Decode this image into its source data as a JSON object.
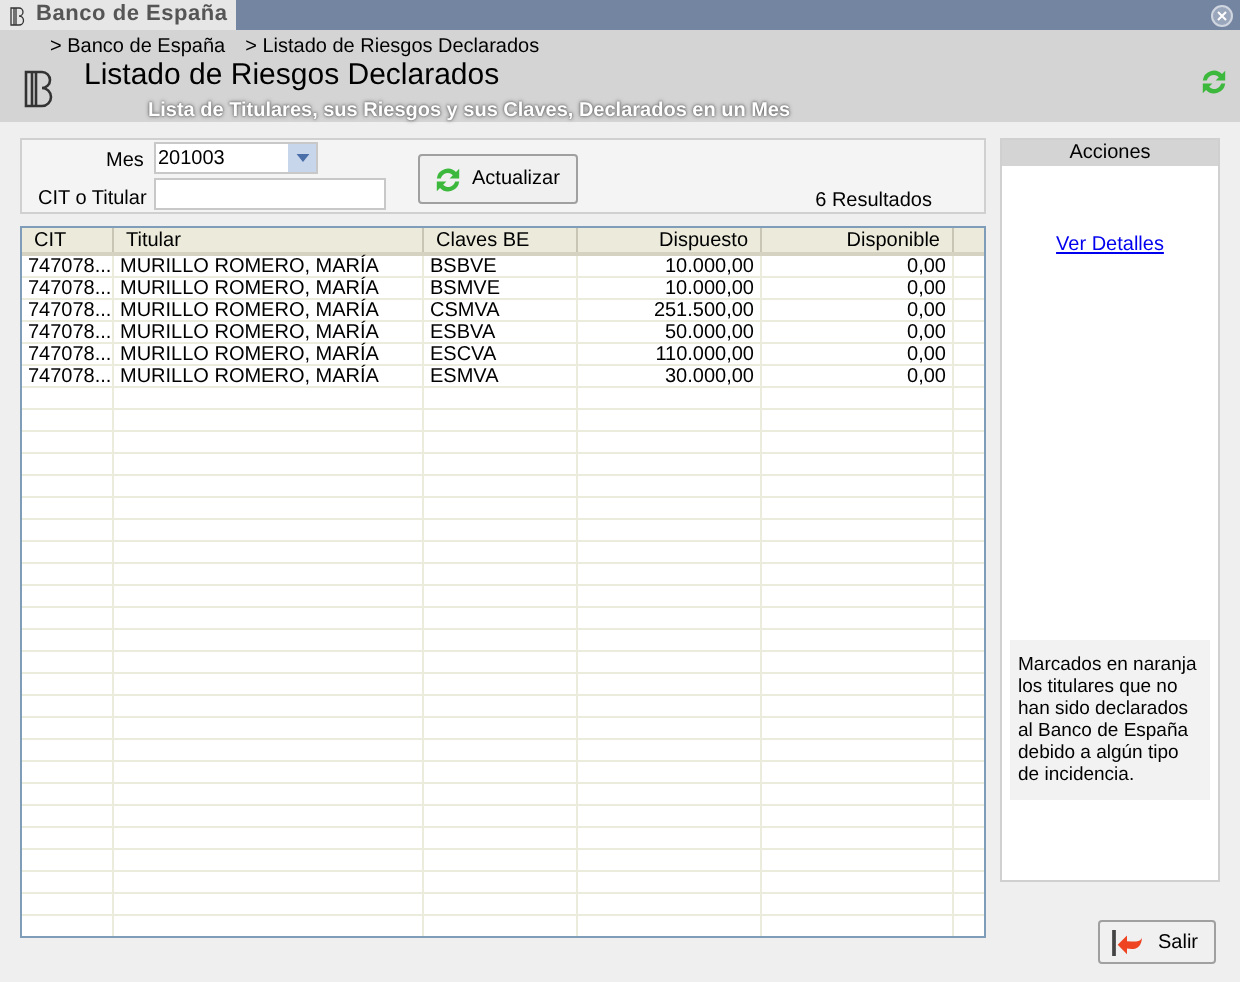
{
  "window": {
    "tab": "Banco de España"
  },
  "breadcrumbs": [
    "> Banco de España",
    "> Listado de Riesgos Declarados"
  ],
  "header": {
    "title": "Listado de Riesgos Declarados",
    "subtitle": "Lista de Titulares, sus Riesgos y sus Claves, Declarados en un Mes"
  },
  "filters": {
    "mes_label": "Mes",
    "mes_value": "201003",
    "cit_label": "CIT o Titular",
    "refresh_button": "Actualizar",
    "result_count": "6 Resultados"
  },
  "table": {
    "columns": [
      "CIT",
      "Titular",
      "Claves BE",
      "Dispuesto",
      "Disponible"
    ],
    "rows": [
      [
        "747078...",
        "MURILLO ROMERO, MARÍA",
        "BSBVE",
        "10.000,00",
        "0,00"
      ],
      [
        "747078...",
        "MURILLO ROMERO, MARÍA",
        "BSMVE",
        "10.000,00",
        "0,00"
      ],
      [
        "747078...",
        "MURILLO ROMERO, MARÍA",
        "CSMVA",
        "251.500,00",
        "0,00"
      ],
      [
        "747078...",
        "MURILLO ROMERO, MARÍA",
        "ESBVA",
        "50.000,00",
        "0,00"
      ],
      [
        "747078...",
        "MURILLO ROMERO, MARÍA",
        "ESCVA",
        "110.000,00",
        "0,00"
      ],
      [
        "747078...",
        "MURILLO ROMERO, MARÍA",
        "ESMVA",
        "30.000,00",
        "0,00"
      ]
    ]
  },
  "actions": {
    "title": "Acciones",
    "link": "Ver Detalles",
    "note": "Marcados en naranja los titulares que no han sido declarados al Banco de España debido a algún tipo de incidencia."
  },
  "exit_button": "Salir"
}
